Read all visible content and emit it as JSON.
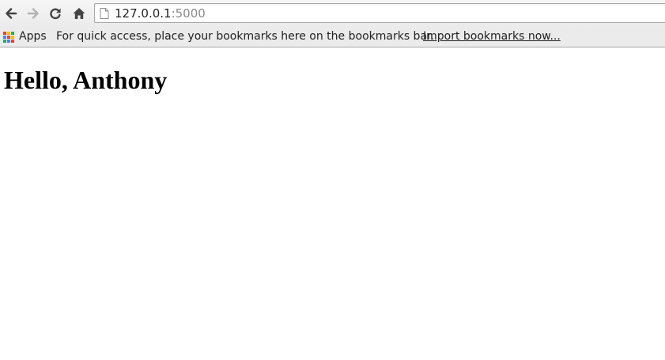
{
  "browser": {
    "address_bar": {
      "host": "127.0.0.1",
      "port": ":5000"
    },
    "nav_buttons": [
      "back",
      "forward",
      "reload",
      "home"
    ],
    "bookmarks_bar": {
      "apps_label": "Apps",
      "hint_text": "For quick access, place your bookmarks here on the bookmarks bar.",
      "import_link": "Import bookmarks now..."
    }
  },
  "page": {
    "heading": "Hello, Anthony"
  },
  "colors": {
    "toolbar_bg": "#ebebeb",
    "apps_icon": [
      "#ea4335",
      "#fbbc05",
      "#34a853",
      "#4285f4",
      "#ea4335",
      "#fbbc05",
      "#34a853",
      "#4285f4",
      "#ea4335"
    ]
  }
}
